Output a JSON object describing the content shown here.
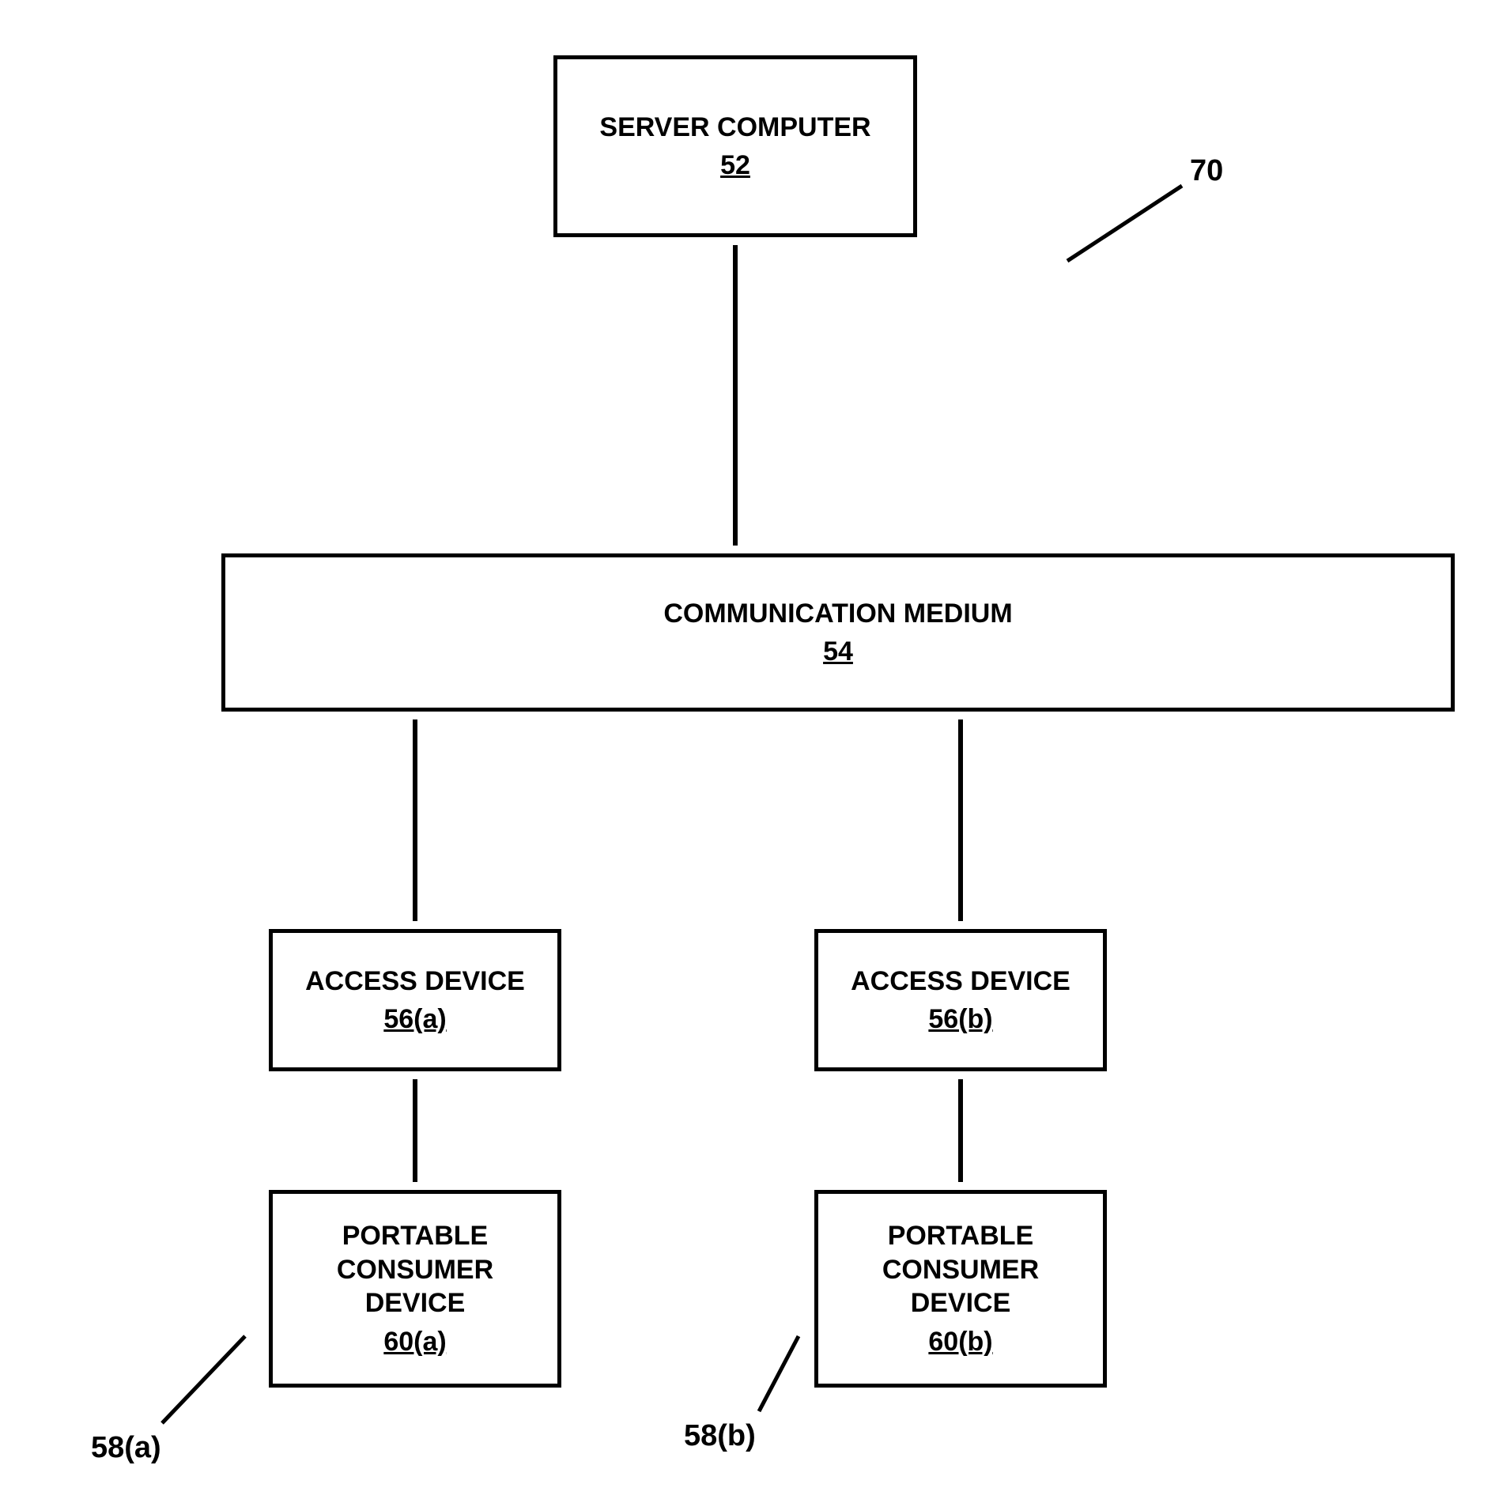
{
  "labels": {
    "system_ref": "70",
    "group_a_ref": "58(a)",
    "group_b_ref": "58(b)"
  },
  "boxes": {
    "server": {
      "title": "SERVER COMPUTER",
      "ref": "52"
    },
    "medium": {
      "title": "COMMUNICATION MEDIUM",
      "ref": "54"
    },
    "access_a": {
      "title": "ACCESS DEVICE",
      "ref": "56(a)"
    },
    "access_b": {
      "title": "ACCESS DEVICE",
      "ref": "56(b)"
    },
    "device_a": {
      "title": "PORTABLE CONSUMER DEVICE",
      "ref": "60(a)"
    },
    "device_b": {
      "title": "PORTABLE CONSUMER DEVICE",
      "ref": "60(b)"
    }
  }
}
